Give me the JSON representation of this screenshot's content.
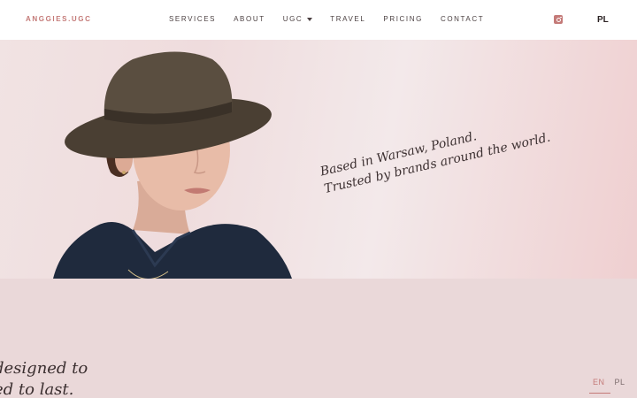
{
  "header": {
    "brand": "ANGGIES.UGC",
    "nav": [
      {
        "label": "SERVICES"
      },
      {
        "label": "ABOUT"
      },
      {
        "label": "UGC"
      },
      {
        "label": "TRAVEL"
      },
      {
        "label": "PRICING"
      },
      {
        "label": "CONTACT"
      }
    ],
    "instagram_icon": "instagram-icon",
    "language_toggle": "PL"
  },
  "hero": {
    "tagline_line1": "Based in Warsaw, Poland.",
    "tagline_line2": "Trusted by brands around the world."
  },
  "section": {
    "quote_line1": "designed to",
    "quote_line2": "ed to last."
  },
  "language_switch": {
    "options": [
      "EN",
      "PL"
    ],
    "active": "EN"
  },
  "colors": {
    "accent": "#c47a78",
    "background": "#ead8d9"
  }
}
